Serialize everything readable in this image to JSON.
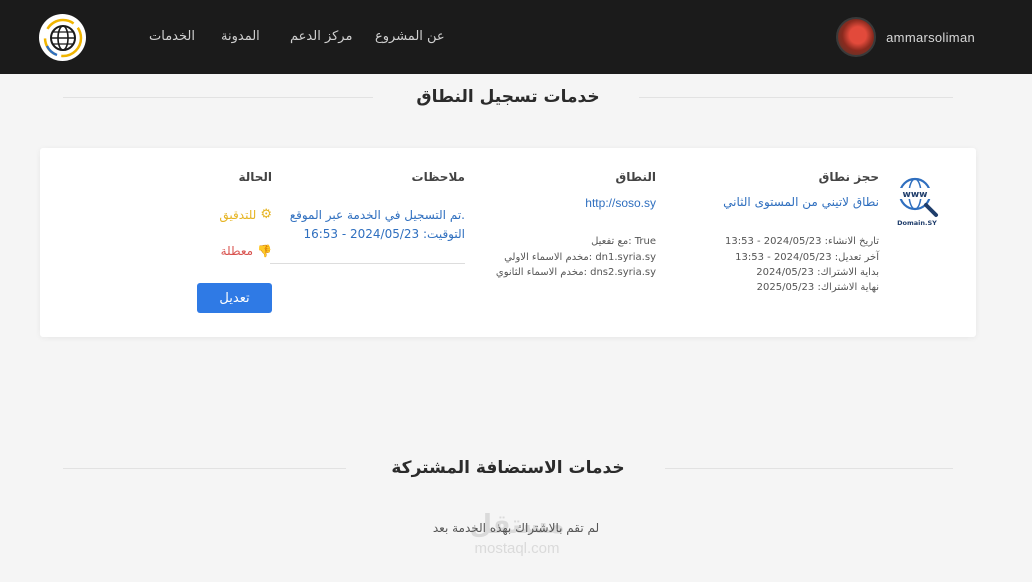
{
  "header": {
    "nav": [
      {
        "label": "عن المشروع"
      },
      {
        "label": "مركز الدعم"
      },
      {
        "label": "المدونة"
      },
      {
        "label": "الخدمات"
      }
    ],
    "username": "ammarsoliman"
  },
  "domain_section": {
    "title": "خدمات تسجيل النطاق",
    "columns": {
      "booking": "حجز نطاق",
      "domain": "النطاق",
      "notes": "ملاحظات",
      "status": "الحالة"
    },
    "booking": {
      "type_link": "نطاق لاتيني من المستوى الثاني",
      "icon_label": "Domain.SY",
      "created": "تاريخ الانشاء: 2024/05/23 - 13:53",
      "modified": "آخر تعديل: 2024/05/23 - 13:53",
      "sub_start": "بداية الاشتراك: 2024/05/23",
      "sub_end": "نهاية الاشتراك: 2025/05/23"
    },
    "domain": {
      "url": "http://soso.sy",
      "activation": "مع تفعيل: True",
      "ns1": "مخدم الاسماء الاولي: dn1.syria.sy",
      "ns2": "مخدم الاسماء الثانوي: dns2.syria.sy"
    },
    "notes": {
      "line1": "تم التسجيل في الخدمة عبر الموقع.",
      "line2": "التوقيت: 2024/05/23 - 16:53"
    },
    "status": {
      "audit": "للتدقيق",
      "disabled": "معطلة"
    },
    "edit_button": "تعديل",
    "colors": {
      "audit": "#e6b422",
      "disabled": "#d9534f",
      "link": "#2f6fbf",
      "button": "#2f7ae5"
    }
  },
  "hosting_section": {
    "title": "خدمات الاستضافة المشتركة",
    "empty_message": "لم تقم بالاشتراك بهذه الخدمة بعد"
  },
  "watermark": {
    "ar": "مستقل",
    "en": "mostaql.com"
  }
}
